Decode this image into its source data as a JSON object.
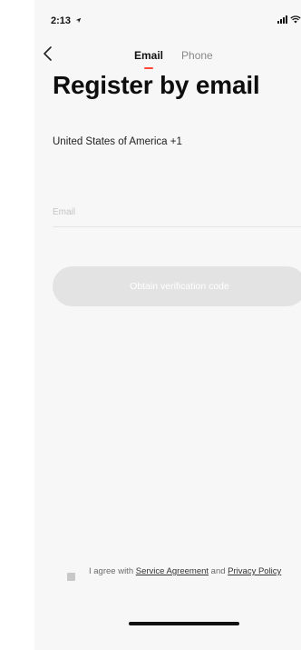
{
  "status_bar": {
    "time": "2:13"
  },
  "nav": {
    "tabs": [
      {
        "label": "Email",
        "active": true
      },
      {
        "label": "Phone",
        "active": false
      }
    ]
  },
  "page": {
    "title": "Register by email",
    "country": "United States of America +1"
  },
  "form": {
    "email_placeholder": "Email",
    "obtain_button_label": "Obtain verification code"
  },
  "agreement": {
    "prefix": "I agree with",
    "service_link": "Service Agreement",
    "and_word": "and",
    "privacy_link": "Privacy Policy"
  },
  "colors": {
    "accent_underline": "#ff4a39",
    "disabled_button": "#e3e3e3"
  }
}
